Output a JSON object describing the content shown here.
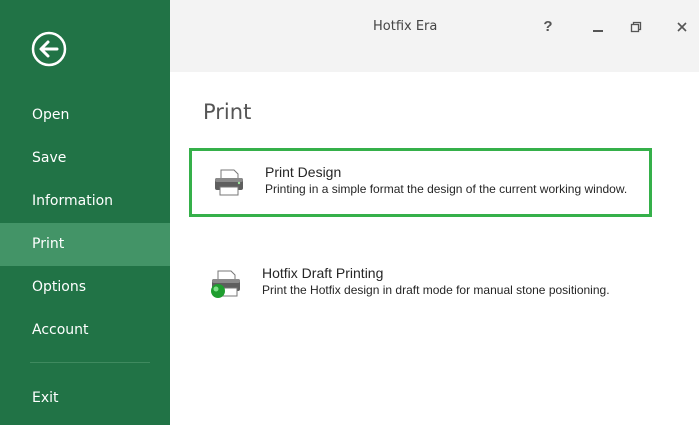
{
  "window": {
    "title": "Hotfix Era",
    "controls": {
      "help": "?",
      "minimize": "_",
      "restore": "🗗",
      "close": "✕"
    }
  },
  "sidebar": {
    "items": [
      {
        "label": "Open"
      },
      {
        "label": "Save"
      },
      {
        "label": "Information"
      },
      {
        "label": "Print",
        "selected": true
      },
      {
        "label": "Options"
      },
      {
        "label": "Account"
      },
      {
        "label": "Exit"
      }
    ]
  },
  "main": {
    "heading": "Print",
    "options": [
      {
        "title": "Print Design",
        "description": "Printing in a simple format the design of the current working window.",
        "icon": "printer-icon",
        "selected": true
      },
      {
        "title": "Hotfix Draft Printing",
        "description": "Print the Hotfix design in draft mode for manual stone positioning.",
        "icon": "printer-draft-icon",
        "selected": false
      }
    ]
  },
  "colors": {
    "sidebar": "#217346",
    "sidebar_selected": "#439467",
    "selection_border": "#35b04a",
    "titlebar": "#f3f3f3"
  }
}
